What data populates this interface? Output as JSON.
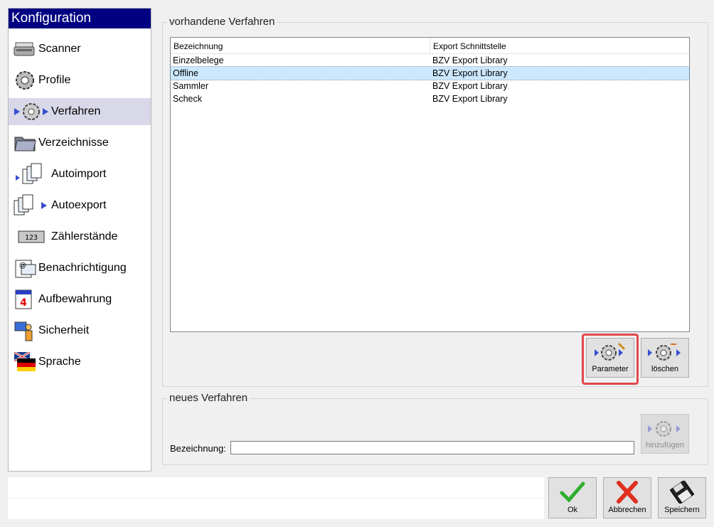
{
  "sidebar": {
    "title": "Konfiguration",
    "items": [
      {
        "label": "Scanner",
        "icon": "scanner-icon"
      },
      {
        "label": "Profile",
        "icon": "gear-icon"
      },
      {
        "label": "Verfahren",
        "icon": "gear-arrows-icon",
        "selected": true
      },
      {
        "label": "Verzeichnisse",
        "icon": "folder-icon"
      },
      {
        "label": "Autoimport",
        "icon": "documents-import-icon"
      },
      {
        "label": "Autoexport",
        "icon": "documents-export-icon"
      },
      {
        "label": "Zählerstände",
        "icon": "counter-icon"
      },
      {
        "label": "Benachrichtigung",
        "icon": "mail-icon"
      },
      {
        "label": "Aufbewahrung",
        "icon": "calendar-icon"
      },
      {
        "label": "Sicherheit",
        "icon": "user-computer-icon"
      },
      {
        "label": "Sprache",
        "icon": "flag-icon"
      }
    ]
  },
  "existing": {
    "title": "vorhandene Verfahren",
    "columns": [
      "Bezeichnung",
      "Export Schnittstelle"
    ],
    "rows": [
      {
        "name": "Einzelbelege",
        "export": "BZV Export Library"
      },
      {
        "name": "Offline",
        "export": "BZV Export Library",
        "selected": true
      },
      {
        "name": "Sammler",
        "export": "BZV Export Library"
      },
      {
        "name": "Scheck",
        "export": "BZV Export Library"
      }
    ],
    "buttons": {
      "parameter": "Parameter",
      "delete": "löschen"
    }
  },
  "new_procedure": {
    "title": "neues Verfahren",
    "field_label": "Bezeichnung:",
    "field_value": "",
    "add_button": "hinzufügen"
  },
  "footer": {
    "ok": "Ok",
    "cancel": "Abbrechen",
    "save": "Speichern"
  },
  "colors": {
    "header_bg": "#000080",
    "selected_row": "#cce8ff",
    "highlight": "#e0484b",
    "ok_green": "#2fae2f",
    "cancel_red": "#e03020"
  }
}
